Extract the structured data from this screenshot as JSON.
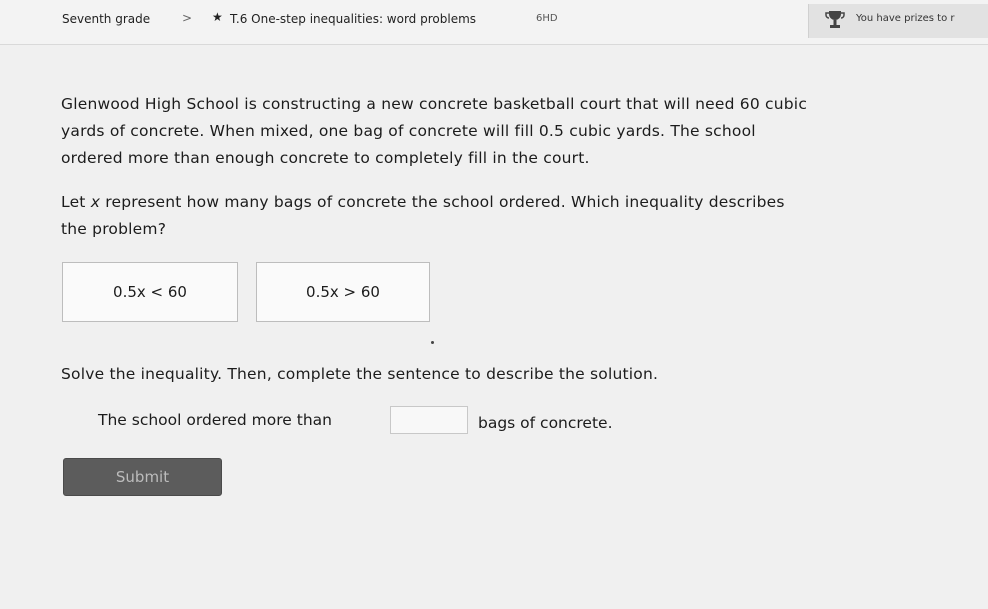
{
  "breadcrumb": {
    "grade": "Seventh grade",
    "separator": ">",
    "skill": "T.6 One-step inequalities: word problems",
    "code": "6HD"
  },
  "prizes": {
    "text": "You have prizes to r",
    "icon": "trophy-icon"
  },
  "question": {
    "lines": [
      "Glenwood High School is constructing a new concrete basketball court that will need 60 cubic",
      "yards of concrete. When mixed, one bag of concrete will fill 0.5 cubic yards. The school",
      "ordered more than enough concrete to completely fill in the court."
    ],
    "prompt_before": "Let ",
    "prompt_var": "x",
    "prompt_after_lines": [
      " represent how many bags of concrete the school ordered. Which inequality describes",
      "the problem?"
    ]
  },
  "choices": [
    {
      "label": "0.5x < 60"
    },
    {
      "label": "0.5x > 60"
    }
  ],
  "solve": {
    "instruction": "Solve the inequality. Then, complete the sentence to describe the solution.",
    "sentence_before": "The school ordered more than",
    "input_value": "",
    "sentence_after": "bags of concrete."
  },
  "submit": {
    "label": "Submit"
  },
  "colors": {
    "submit_bg": "#5c5c5c",
    "submit_text": "#bcbcbc",
    "background": "#f0f0f0"
  }
}
